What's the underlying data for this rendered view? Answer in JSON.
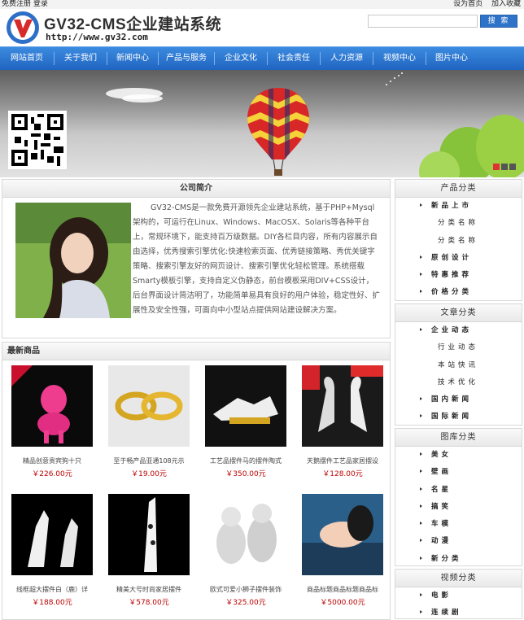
{
  "topbar": {
    "register": "免费注册",
    "login": "登录",
    "set_home": "设为首页",
    "add_fav": "加入收藏"
  },
  "header": {
    "site_name": "GV32-CMS企业建站系统",
    "site_url": "http://www.gv32.com"
  },
  "search": {
    "placeholder": "",
    "button": "搜 索"
  },
  "nav": [
    "网站首页",
    "关于我们",
    "新闻中心",
    "产品与服务",
    "企业文化",
    "社会责任",
    "人力资源",
    "视频中心",
    "图片中心"
  ],
  "about": {
    "title": "公司简介",
    "text": "GV32-CMS是一款免费开源领先企业建站系统，基于PHP+Mysql架构的，可运行在Linux、Windows、MacOSX、Solaris等各种平台上，常规环境下，能支持百万级数据。DIY各栏目内容，所有内容展示自由选择，优秀搜索引擎优化:快速检索页面、优秀链接策略、秀优关键字策略、搜索引擎友好的网页设计、搜索引擎优化轻松管理。系统搭载Smarty模板引擎，支持自定义伪静态，前台模板采用DIV+CSS设计，后台界面设计简洁明了，功能简单易具有良好的用户体验，稳定性好、扩展性及安全性强，可面向中小型站点提供网站建设解决方案。"
  },
  "products": {
    "title": "最新商品",
    "items": [
      {
        "name": "精品创意贵宾狗十只",
        "price": "￥226.00元"
      },
      {
        "name": "至于畅产品亚通108元示",
        "price": "￥19.00元"
      },
      {
        "name": "工艺品摆件马的摆件陶式",
        "price": "￥350.00元"
      },
      {
        "name": "天鹅摆件工艺品家居摆设",
        "price": "￥128.00元"
      },
      {
        "name": "线框超大摆件白（鹿）详",
        "price": "￥188.00元"
      },
      {
        "name": "精美大号时尚家居摆件",
        "price": "￥578.00元"
      },
      {
        "name": "欧式可爱小狮子摆件装饰",
        "price": "￥325.00元"
      },
      {
        "name": "商品标题商品标题商品标",
        "price": "￥5000.00元"
      }
    ]
  },
  "sidebar": [
    {
      "title": "产品分类",
      "items": [
        {
          "label": "新品上市",
          "level": 1
        },
        {
          "label": "分类名称",
          "level": 2
        },
        {
          "label": "分类名称",
          "level": 2
        },
        {
          "label": "原创设计",
          "level": 1
        },
        {
          "label": "特惠推荐",
          "level": 1
        },
        {
          "label": "价格分类",
          "level": 1
        }
      ]
    },
    {
      "title": "文章分类",
      "items": [
        {
          "label": "企业动态",
          "level": 1
        },
        {
          "label": "行业动态",
          "level": 2
        },
        {
          "label": "本站快讯",
          "level": 2
        },
        {
          "label": "技术优化",
          "level": 2
        },
        {
          "label": "国内新闻",
          "level": 1
        },
        {
          "label": "国际新闻",
          "level": 1
        }
      ]
    },
    {
      "title": "图库分类",
      "items": [
        {
          "label": "美女",
          "level": 1
        },
        {
          "label": "壁画",
          "level": 1
        },
        {
          "label": "名星",
          "level": 1
        },
        {
          "label": "搞笑",
          "level": 1
        },
        {
          "label": "车模",
          "level": 1
        },
        {
          "label": "动漫",
          "level": 1
        },
        {
          "label": "新分类",
          "level": 1
        }
      ]
    },
    {
      "title": "视频分类",
      "items": [
        {
          "label": "电影",
          "level": 1
        },
        {
          "label": "连续剧",
          "level": 1
        }
      ]
    }
  ],
  "colors": {
    "nav": "#2f73c9",
    "price": "#bb0000"
  }
}
